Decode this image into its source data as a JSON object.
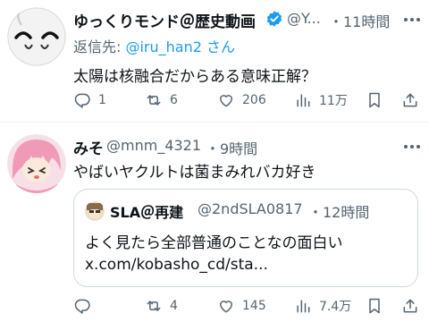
{
  "tweet1": {
    "display_name": "ゆっくりモンド＠歴史動画",
    "handle": "@Y...",
    "time": "・11時間",
    "reply_prefix": "返信先: ",
    "reply_to": "@iru_han2",
    "reply_suffix": " さん",
    "text": "太陽は核融合だからある意味正解？",
    "stats": {
      "replies": "1",
      "retweets": "6",
      "likes": "206",
      "views": "11万"
    }
  },
  "tweet2": {
    "display_name": "みそ",
    "handle": "@mnm_4321",
    "time": "・9時間",
    "text": "やばいヤクルトは菌まみれバカ好き",
    "quote": {
      "display_name": "SLA＠再建",
      "handle": "@2ndSLA0817",
      "time": "・12時間",
      "text": "よく見たら全部普通のことなの面白い",
      "link": "x.com/kobasho_cd/sta..."
    },
    "stats": {
      "replies": "",
      "retweets": "4",
      "likes": "145",
      "views": "7.4万"
    }
  },
  "colors": {
    "link": "#1d9bf0",
    "verified": "#1d9bf0",
    "muted": "#536471"
  }
}
